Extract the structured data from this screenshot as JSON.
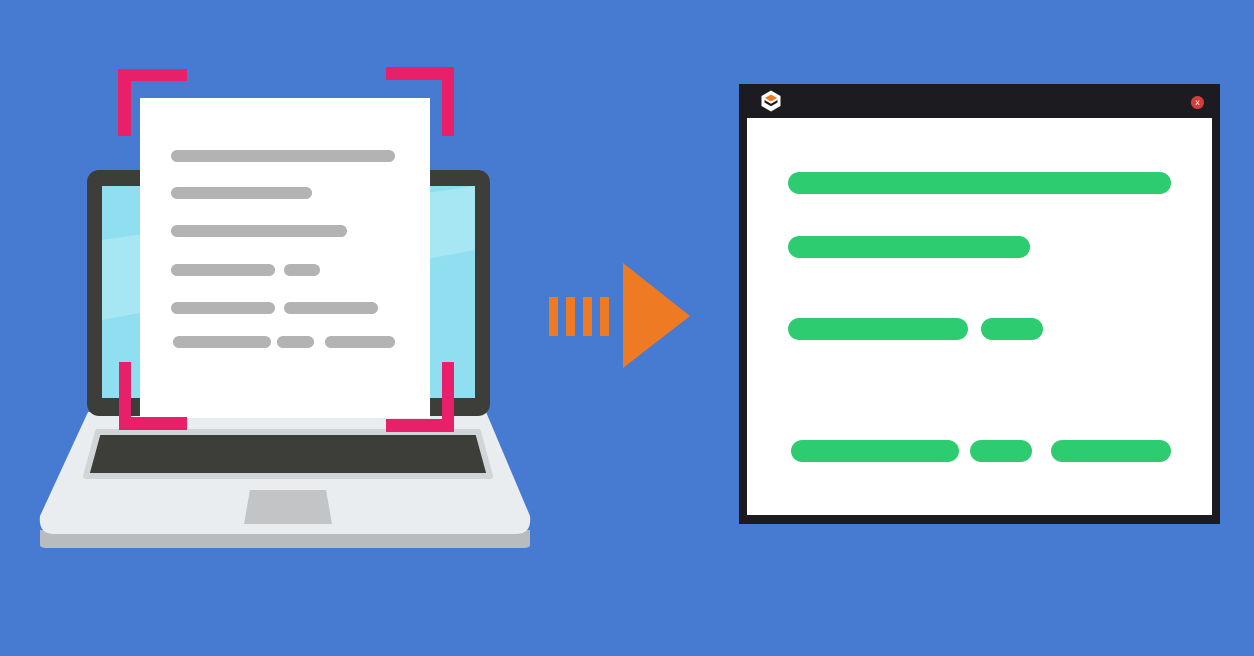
{
  "colors": {
    "background": "#477bd2",
    "document_line": "#b3b3b3",
    "extracted_line": "#2ecc71",
    "scan_corner": "#e8206a",
    "arrow": "#ee7a23",
    "laptop_bezel": "#3d3d3a",
    "laptop_screen": "#8fdff0",
    "window_frame": "#1c1b20",
    "close_button": "#d93a3a"
  },
  "icons": {
    "app": "hexagon-logo-icon",
    "close": "close-icon",
    "arrow": "arrow-right-icon",
    "scan": "scan-corner-icon"
  },
  "output_window": {
    "close_label": "x"
  }
}
